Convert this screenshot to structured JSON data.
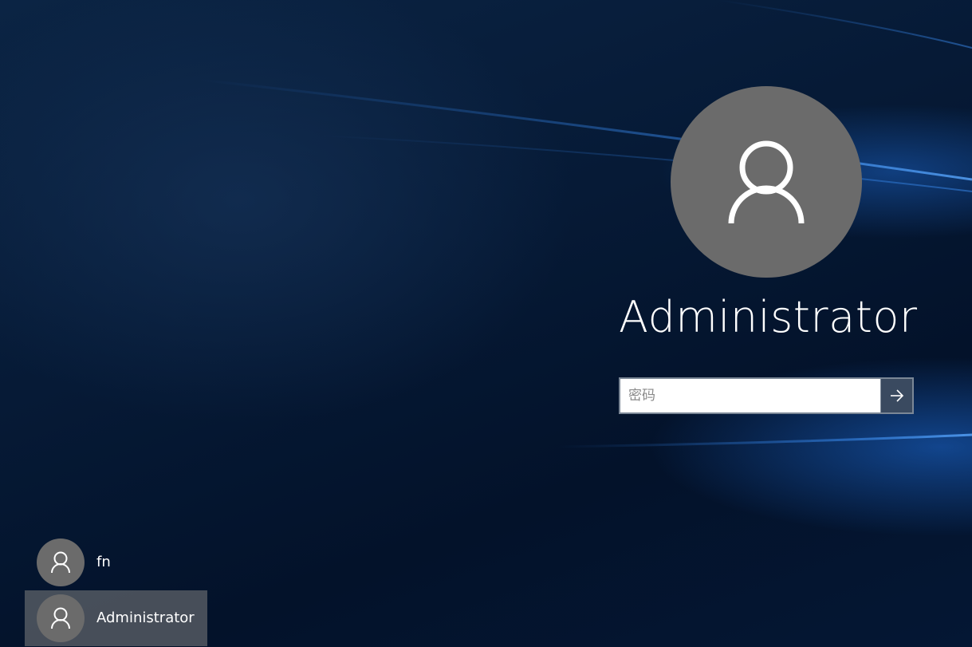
{
  "login": {
    "username": "Administrator",
    "password_placeholder": "密码",
    "submit_icon": "arrow-right-icon",
    "avatar_icon": "user-icon"
  },
  "users": [
    {
      "name": "fn",
      "selected": false,
      "avatar_icon": "user-icon"
    },
    {
      "name": "Administrator",
      "selected": true,
      "avatar_icon": "user-icon"
    }
  ],
  "colors": {
    "avatar_bg": "#6b6b6b",
    "submit_bg": "#3a4a60",
    "selected_bg": "#808080",
    "background": "#061a36"
  }
}
